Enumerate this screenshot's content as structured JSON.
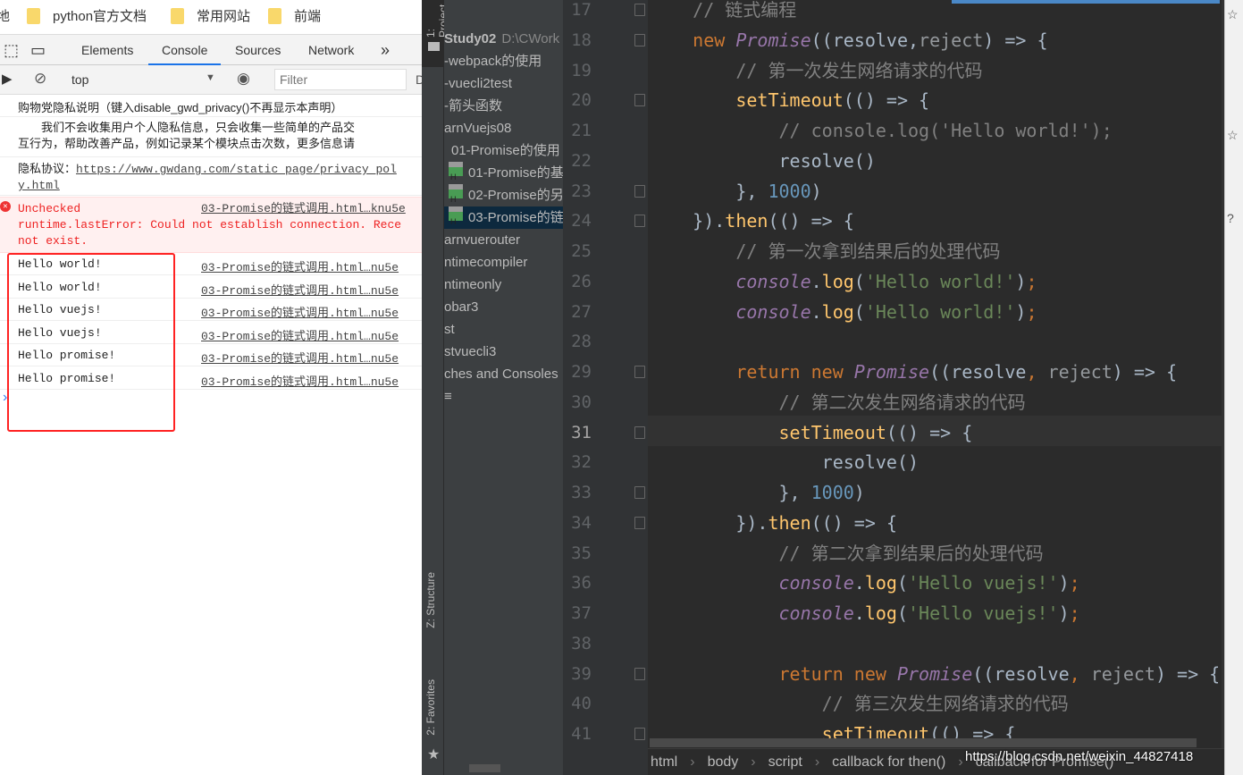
{
  "browser": {
    "bookmarks": [
      "python官方文档",
      "常用网站",
      "前端"
    ],
    "bookmark_cut": "地",
    "devtools_tabs": [
      "Elements",
      "Console",
      "Sources",
      "Network"
    ],
    "more_tabs": "»",
    "context": "top",
    "filter_placeholder": "Filter",
    "filter_cut": "D",
    "messages": {
      "privacy_title": "购物党隐私说明（键入disable_gwd_privacy()不再显示本声明）",
      "privacy_body_1": "　　我们不会收集用户个人隐私信息，只会收集一些简单的产品交",
      "privacy_body_2": "互行为，帮助改善产品，例如记录某个模块点击次数，更多信息请",
      "privacy_link_label": "隐私协议：",
      "privacy_link_1": "https://www.gwdang.com/static_page/privacy_pol",
      "privacy_link_2": "y.html",
      "error_1": "Unchecked",
      "error_2": "runtime.lastError: Could not establish connection. Rece",
      "error_3": "not exist.",
      "error_src": "03-Promise的链式调用.html…knu5e",
      "logs": [
        {
          "text": "Hello world!",
          "src": "03-Promise的链式调用.html…nu5e"
        },
        {
          "text": "Hello world!",
          "src": "03-Promise的链式调用.html…nu5e"
        },
        {
          "text": "Hello vuejs!",
          "src": "03-Promise的链式调用.html…nu5e"
        },
        {
          "text": "Hello vuejs!",
          "src": "03-Promise的链式调用.html…nu5e"
        },
        {
          "text": "Hello promise!",
          "src": "03-Promise的链式调用.html…nu5e"
        },
        {
          "text": "Hello promise!",
          "src": "03-Promise的链式调用.html…nu5e"
        }
      ],
      "prompt": "›"
    }
  },
  "ide": {
    "tool_tabs": {
      "project": "1: Project",
      "structure": "Z: Structure",
      "favorites": "2: Favorites"
    },
    "tree": [
      {
        "label": "Study02",
        "extra": "D:\\CWork"
      },
      {
        "label": "-webpack的使用"
      },
      {
        "label": "-vuecli2test"
      },
      {
        "label": "-箭头函数"
      },
      {
        "label": "arnVuejs08"
      },
      {
        "label": "01-Promise的使用"
      },
      {
        "label": "01-Promise的基",
        "file": true
      },
      {
        "label": "02-Promise的另",
        "file": true
      },
      {
        "label": "03-Promise的链",
        "file": true,
        "selected": true
      },
      {
        "label": "arnvuerouter"
      },
      {
        "label": "ntimecompiler"
      },
      {
        "label": "ntimeonly"
      },
      {
        "label": "obar3"
      },
      {
        "label": "st"
      },
      {
        "label": "stvuecli3"
      },
      {
        "label": "ches and Consoles"
      },
      {
        "label": "≡"
      }
    ],
    "current_line": 31,
    "lines": [
      {
        "n": 17,
        "fold": true,
        "t": [
          [
            "cm",
            "    // 链式编程"
          ]
        ]
      },
      {
        "n": 18,
        "fold": true,
        "t": [
          [
            "kw",
            "    new "
          ],
          [
            "cls",
            "Promise"
          ],
          [
            "",
            "((resolve,"
          ],
          [
            "par",
            "reject"
          ],
          [
            "",
            ") => {"
          ]
        ]
      },
      {
        "n": 19,
        "t": [
          [
            "cm",
            "        // 第一次发生网络请求的代码"
          ]
        ]
      },
      {
        "n": 20,
        "fold": true,
        "t": [
          [
            "fn",
            "        setTimeout"
          ],
          [
            "",
            "(() => {"
          ]
        ]
      },
      {
        "n": 21,
        "t": [
          [
            "cm",
            "            // console.log('Hello world!');"
          ]
        ]
      },
      {
        "n": 22,
        "t": [
          [
            "",
            "            resolve()"
          ]
        ]
      },
      {
        "n": 23,
        "fold": true,
        "t": [
          [
            "",
            "        }, "
          ],
          [
            "num",
            "1000"
          ],
          [
            "",
            ")"
          ]
        ]
      },
      {
        "n": 24,
        "fold": true,
        "t": [
          [
            "",
            "    })."
          ],
          [
            "fn",
            "then"
          ],
          [
            "",
            "(() => {"
          ]
        ]
      },
      {
        "n": 25,
        "t": [
          [
            "cm",
            "        // 第一次拿到结果后的处理代码"
          ]
        ]
      },
      {
        "n": 26,
        "t": [
          [
            "con",
            "        console"
          ],
          [
            "",
            "."
          ],
          [
            "fn",
            "log"
          ],
          [
            "",
            "("
          ],
          [
            "str",
            "'Hello world!'"
          ],
          [
            "",
            ")"
          ],
          [
            "kw",
            ";"
          ]
        ]
      },
      {
        "n": 27,
        "t": [
          [
            "con",
            "        console"
          ],
          [
            "",
            "."
          ],
          [
            "fn",
            "log"
          ],
          [
            "",
            "("
          ],
          [
            "str",
            "'Hello world!'"
          ],
          [
            "",
            ")"
          ],
          [
            "kw",
            ";"
          ]
        ]
      },
      {
        "n": 28,
        "t": []
      },
      {
        "n": 29,
        "fold": true,
        "t": [
          [
            "kw",
            "        return new "
          ],
          [
            "cls",
            "Promise"
          ],
          [
            "",
            "((resolve"
          ],
          [
            "kw",
            ", "
          ],
          [
            "par",
            "reject"
          ],
          [
            "",
            ") => {"
          ]
        ]
      },
      {
        "n": 30,
        "t": [
          [
            "cm",
            "            // 第二次发生网络请求的代码"
          ]
        ]
      },
      {
        "n": 31,
        "fold": true,
        "t": [
          [
            "fn",
            "            setTimeout"
          ],
          [
            "",
            "(() => {"
          ]
        ]
      },
      {
        "n": 32,
        "t": [
          [
            "",
            "                resolve()"
          ]
        ]
      },
      {
        "n": 33,
        "fold": true,
        "t": [
          [
            "",
            "            }, "
          ],
          [
            "num",
            "1000"
          ],
          [
            "",
            ")"
          ]
        ]
      },
      {
        "n": 34,
        "fold": true,
        "t": [
          [
            "",
            "        })."
          ],
          [
            "fn",
            "then"
          ],
          [
            "",
            "(() => {"
          ]
        ]
      },
      {
        "n": 35,
        "t": [
          [
            "cm",
            "            // 第二次拿到结果后的处理代码"
          ]
        ]
      },
      {
        "n": 36,
        "t": [
          [
            "con",
            "            console"
          ],
          [
            "",
            "."
          ],
          [
            "fn",
            "log"
          ],
          [
            "",
            "("
          ],
          [
            "str",
            "'Hello vuejs!'"
          ],
          [
            "",
            ")"
          ],
          [
            "kw",
            ";"
          ]
        ]
      },
      {
        "n": 37,
        "t": [
          [
            "con",
            "            console"
          ],
          [
            "",
            "."
          ],
          [
            "fn",
            "log"
          ],
          [
            "",
            "("
          ],
          [
            "str",
            "'Hello vuejs!'"
          ],
          [
            "",
            ")"
          ],
          [
            "kw",
            ";"
          ]
        ]
      },
      {
        "n": 38,
        "t": []
      },
      {
        "n": 39,
        "fold": true,
        "t": [
          [
            "kw",
            "            return new "
          ],
          [
            "cls",
            "Promise"
          ],
          [
            "",
            "((resolve"
          ],
          [
            "kw",
            ", "
          ],
          [
            "par",
            "reject"
          ],
          [
            "",
            ") => {"
          ]
        ]
      },
      {
        "n": 40,
        "t": [
          [
            "cm",
            "                // 第三次发生网络请求的代码"
          ]
        ]
      },
      {
        "n": 41,
        "fold": true,
        "t": [
          [
            "fn",
            "                setTimeout"
          ],
          [
            "",
            "(() => {"
          ]
        ]
      }
    ],
    "breadcrumbs": [
      "html",
      "body",
      "script",
      "callback for then()",
      "callback for Promise()"
    ],
    "watermark": "https://blog.csdn.net/weixin_44827418"
  }
}
